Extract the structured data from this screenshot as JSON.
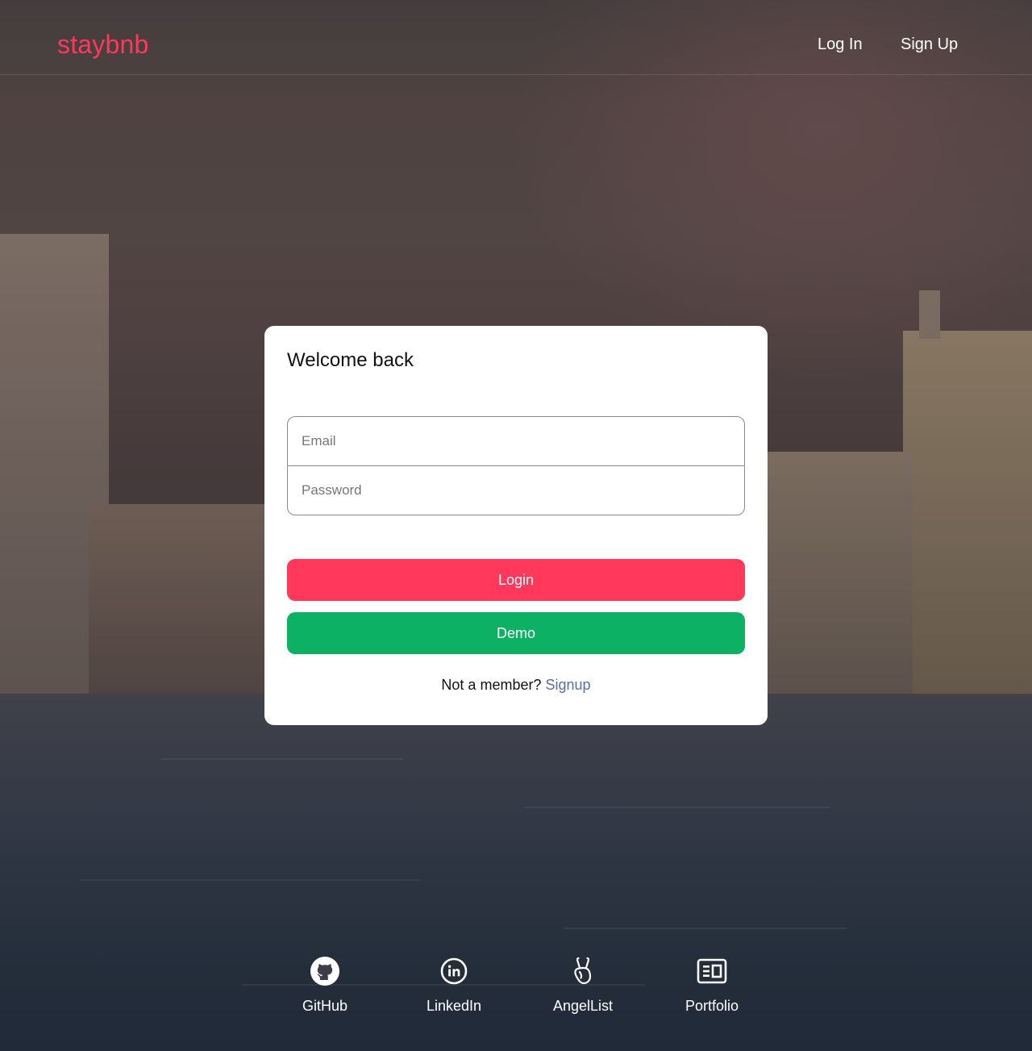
{
  "header": {
    "logo": "staybnb",
    "nav": {
      "login_label": "Log In",
      "signup_label": "Sign Up"
    }
  },
  "modal": {
    "title": "Welcome back",
    "email": {
      "placeholder": "Email",
      "value": ""
    },
    "password": {
      "placeholder": "Password",
      "value": ""
    },
    "login_button": "Login",
    "demo_button": "Demo",
    "member_prompt": "Not a member?",
    "signup_link": "Signup"
  },
  "footer": {
    "links": [
      {
        "label": "GitHub",
        "icon": "github-icon"
      },
      {
        "label": "LinkedIn",
        "icon": "linkedin-icon"
      },
      {
        "label": "AngelList",
        "icon": "angellist-icon"
      },
      {
        "label": "Portfolio",
        "icon": "portfolio-icon"
      }
    ]
  },
  "colors": {
    "brand": "#ff385c",
    "demo": "#0db163",
    "link": "#5b6f9a"
  }
}
